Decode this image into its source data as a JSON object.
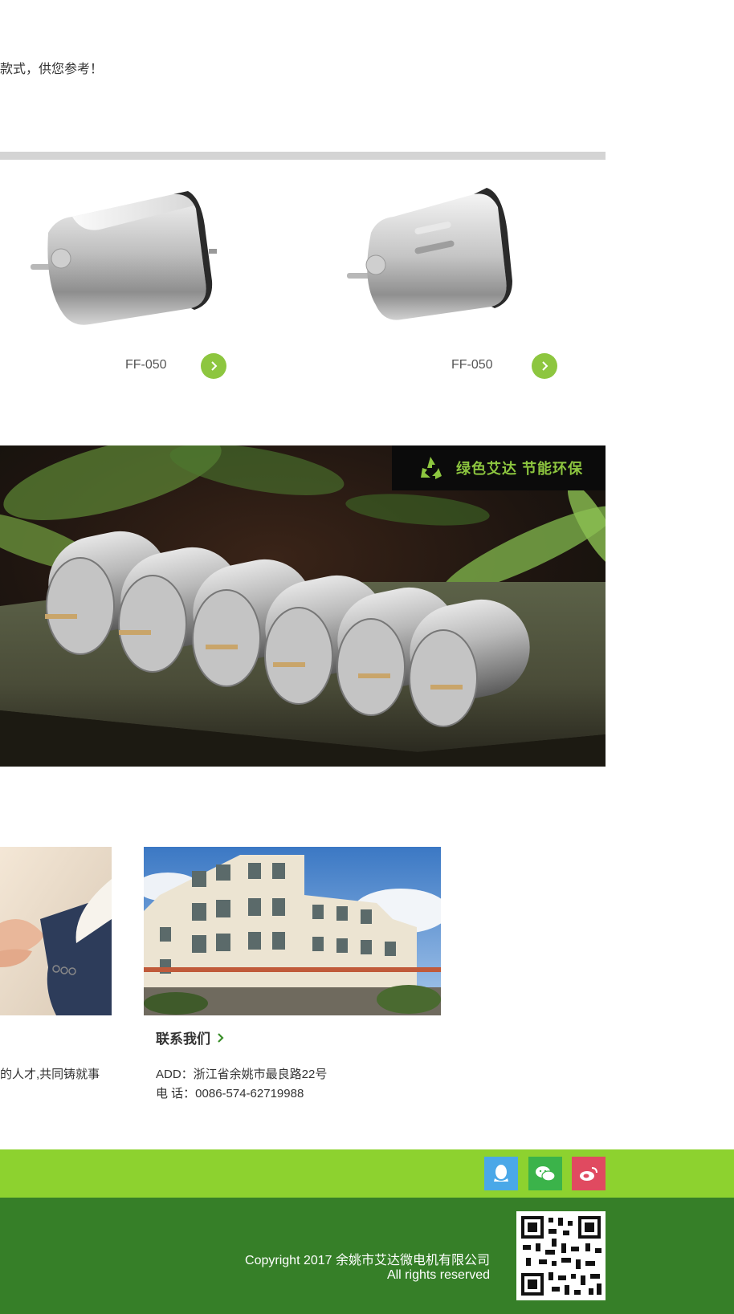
{
  "intro": {
    "text": "款式，供您参考！"
  },
  "products": [
    {
      "model": "FF-050",
      "more_icon": "chevron-right-icon"
    },
    {
      "model": "FF-050",
      "more_icon": "chevron-right-icon"
    }
  ],
  "banner": {
    "tag": "绿色艾达 节能环保",
    "tag_icon": "recycle-icon"
  },
  "cards": {
    "card1_text": "的人才,共同铸就事",
    "contact_title": "联系我们",
    "address": "ADD：浙江省余姚市最良路22号",
    "phone": "电 话：0086-574-62719988"
  },
  "footer": {
    "copyright": "Copyright 2017 余姚市艾达微电机有限公司",
    "rights": "All rights reserved",
    "social": [
      "qq-icon",
      "wechat-icon",
      "weibo-icon"
    ]
  },
  "colors": {
    "accent_green": "#8dc63f",
    "bar_green": "#8dd22f",
    "footer_green": "#367f28",
    "qq_blue": "#4aa8e8",
    "wechat_green": "#3bb34a",
    "weibo_red": "#e04a60"
  }
}
